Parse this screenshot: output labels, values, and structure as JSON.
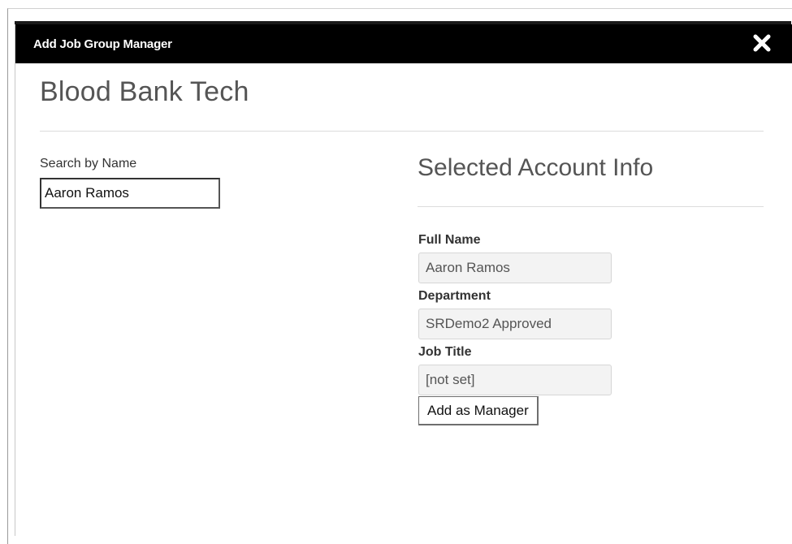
{
  "dialog": {
    "title": "Add Job Group Manager",
    "close_icon": "close-icon"
  },
  "page": {
    "title": "Blood Bank Tech"
  },
  "search": {
    "label": "Search by Name",
    "value": "Aaron Ramos"
  },
  "account_info": {
    "heading": "Selected Account Info",
    "full_name_label": "Full Name",
    "full_name_value": "Aaron Ramos",
    "department_label": "Department",
    "department_value": "SRDemo2 Approved",
    "job_title_label": "Job Title",
    "job_title_value": "[not set]",
    "add_button_label": "Add as Manager"
  },
  "colors": {
    "header_background": "#000000",
    "header_text": "#ffffff",
    "heading_text": "#555555",
    "readonly_field_background": "#f3f3f3"
  }
}
